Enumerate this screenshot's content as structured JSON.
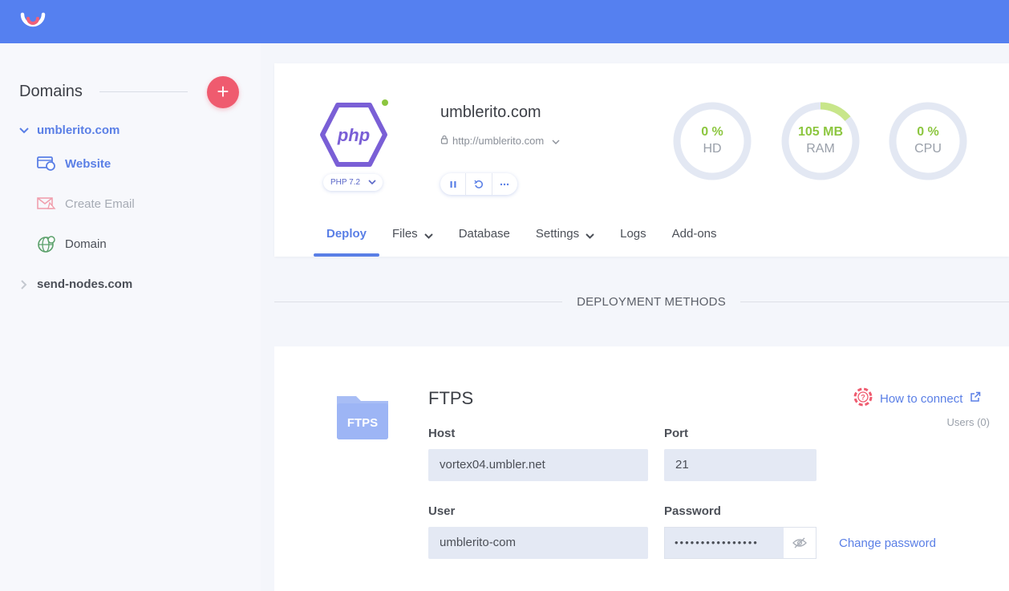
{
  "sidebar": {
    "title": "Domains",
    "add_label": "+",
    "domains": [
      {
        "name": "umblerito.com",
        "expanded": true,
        "items": [
          {
            "label": "Website",
            "icon": "website-icon",
            "active": true
          },
          {
            "label": "Create Email",
            "icon": "email-icon",
            "active": false
          },
          {
            "label": "Domain",
            "icon": "globe-icon",
            "active": false
          }
        ]
      },
      {
        "name": "send-nodes.com",
        "expanded": false
      }
    ]
  },
  "site": {
    "name": "umblerito.com",
    "url": "http://umblerito.com",
    "php_version": "PHP 7.2",
    "status_color": "#8cc63f"
  },
  "gauges": [
    {
      "value": "0 %",
      "label": "HD",
      "fraction": 0
    },
    {
      "value": "105 MB",
      "label": "RAM",
      "fraction": 0.14
    },
    {
      "value": "0 %",
      "label": "CPU",
      "fraction": 0
    }
  ],
  "tabs": [
    {
      "label": "Deploy",
      "active": true,
      "dropdown": false
    },
    {
      "label": "Files",
      "active": false,
      "dropdown": true
    },
    {
      "label": "Database",
      "active": false,
      "dropdown": false
    },
    {
      "label": "Settings",
      "active": false,
      "dropdown": true
    },
    {
      "label": "Logs",
      "active": false,
      "dropdown": false
    },
    {
      "label": "Add-ons",
      "active": false,
      "dropdown": false
    }
  ],
  "section_title": "DEPLOYMENT METHODS",
  "ftps": {
    "folder_label": "FTPS",
    "title": "FTPS",
    "how_to_connect": "How to connect",
    "users": "Users (0)",
    "host_label": "Host",
    "host_value": "vortex04.umbler.net",
    "port_label": "Port",
    "port_value": "21",
    "user_label": "User",
    "user_value": "umblerito-com",
    "password_label": "Password",
    "password_mask": "••••••••••••••••",
    "change_password": "Change password"
  },
  "colors": {
    "topbar": "#5580f0",
    "accent": "#5a7fe6",
    "add_button": "#ef5b6f",
    "gauge_ok": "#8cc63f"
  }
}
